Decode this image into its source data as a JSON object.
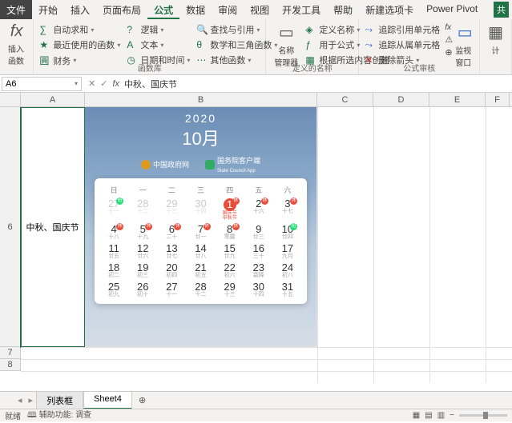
{
  "menu": {
    "file": "文件",
    "items": [
      "开始",
      "插入",
      "页面布局",
      "公式",
      "数据",
      "审阅",
      "视图",
      "开发工具",
      "帮助",
      "新建选项卡",
      "Power Pivot"
    ],
    "active_index": 3,
    "share": "共"
  },
  "ribbon": {
    "insert_fn": {
      "icon": "fx",
      "label": "插入函数"
    },
    "lib": {
      "autosum": "自动求和",
      "recent": "最近使用的函数",
      "financial": "财务",
      "logical": "逻辑",
      "text": "文本",
      "datetime": "日期和时间",
      "lookup": "查找与引用",
      "math": "数学和三角函数",
      "other": "其他函数",
      "group_label": "函数库"
    },
    "names": {
      "manager": "名称\n管理器",
      "define": "定义名称",
      "use": "用于公式",
      "create": "根据所选内容创建",
      "group_label": "定义的名称"
    },
    "audit": {
      "trace_pred": "追踪引用单元格",
      "trace_dep": "追踪从属单元格",
      "remove_arrows": "删除箭头",
      "fx": "fx",
      "err": "⚠",
      "eval": "⊕",
      "watch": "监视窗口",
      "group_label": "公式审核"
    },
    "calc": {
      "label": "计"
    }
  },
  "namebox": "A6",
  "formula_bar": {
    "value": "中秋、国庆节"
  },
  "columns": [
    "A",
    "B",
    "C",
    "D",
    "E",
    "F"
  ],
  "rows": [
    "6",
    "7",
    "8"
  ],
  "cellA6": "中秋、国庆节",
  "calendar": {
    "year": "2020",
    "month": "10月",
    "gov": "中国政府网",
    "app": "国务院客户端",
    "app_sub": "State Council App",
    "dow": [
      "日",
      "一",
      "二",
      "三",
      "四",
      "五",
      "六"
    ],
    "rest": "休",
    "work": "班",
    "weeks": [
      [
        {
          "n": "27",
          "s": "十一",
          "dim": true,
          "b": "work"
        },
        {
          "n": "28",
          "s": "十二",
          "dim": true
        },
        {
          "n": "29",
          "s": "十三",
          "dim": true
        },
        {
          "n": "30",
          "s": "十四",
          "dim": true
        },
        {
          "n": "1",
          "s": "国庆节\n中秋节",
          "hl": true,
          "b": "rest"
        },
        {
          "n": "2",
          "s": "十六",
          "b": "rest"
        },
        {
          "n": "3",
          "s": "十七",
          "b": "rest"
        }
      ],
      [
        {
          "n": "4",
          "s": "十八",
          "b": "rest"
        },
        {
          "n": "5",
          "s": "十九",
          "b": "rest"
        },
        {
          "n": "6",
          "s": "二十",
          "b": "rest"
        },
        {
          "n": "7",
          "s": "廿一",
          "b": "rest"
        },
        {
          "n": "8",
          "s": "寒露",
          "b": "rest"
        },
        {
          "n": "9",
          "s": "廿三"
        },
        {
          "n": "10",
          "s": "廿四",
          "b": "work"
        }
      ],
      [
        {
          "n": "11",
          "s": "廿五"
        },
        {
          "n": "12",
          "s": "廿六"
        },
        {
          "n": "13",
          "s": "廿七"
        },
        {
          "n": "14",
          "s": "廿八"
        },
        {
          "n": "15",
          "s": "廿九"
        },
        {
          "n": "16",
          "s": "三十"
        },
        {
          "n": "17",
          "s": "九月"
        }
      ],
      [
        {
          "n": "18",
          "s": "初二"
        },
        {
          "n": "19",
          "s": "初三"
        },
        {
          "n": "20",
          "s": "初四"
        },
        {
          "n": "21",
          "s": "初五"
        },
        {
          "n": "22",
          "s": "初六"
        },
        {
          "n": "23",
          "s": "霜降"
        },
        {
          "n": "24",
          "s": "初八"
        }
      ],
      [
        {
          "n": "25",
          "s": "初九"
        },
        {
          "n": "26",
          "s": "初十"
        },
        {
          "n": "27",
          "s": "十一"
        },
        {
          "n": "28",
          "s": "十二"
        },
        {
          "n": "29",
          "s": "十三"
        },
        {
          "n": "30",
          "s": "十四"
        },
        {
          "n": "31",
          "s": "十五"
        }
      ]
    ]
  },
  "sheets": {
    "tabs": [
      "列表框",
      "Sheet4"
    ],
    "active_index": 1
  },
  "status": {
    "ready": "就绪",
    "acc": "辅助功能: 调查"
  }
}
